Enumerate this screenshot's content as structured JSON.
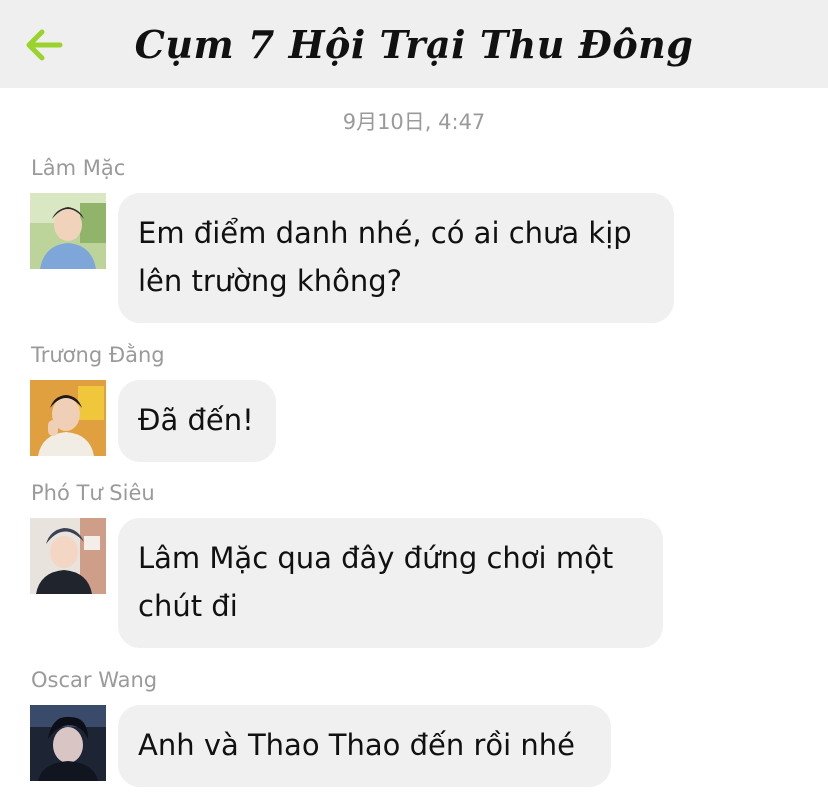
{
  "header": {
    "title": "Cụm 7 Hội Trại Thu Đông",
    "back_icon": "arrow-left-icon",
    "accent_color": "#9ad32c"
  },
  "chat": {
    "timestamp": "9月10日, 4:47",
    "messages": [
      {
        "sender": "Lâm Mặc",
        "text": "Em điểm danh nhé, có ai chưa kịp lên trường không?"
      },
      {
        "sender": "Trương Đằng",
        "text": "Đã đến!"
      },
      {
        "sender": "Phó Tư Siêu",
        "text": "Lâm Mặc qua đây đứng chơi một chút đi"
      },
      {
        "sender": "Oscar Wang",
        "text": "Anh và Thao Thao đến rồi nhé"
      }
    ]
  }
}
